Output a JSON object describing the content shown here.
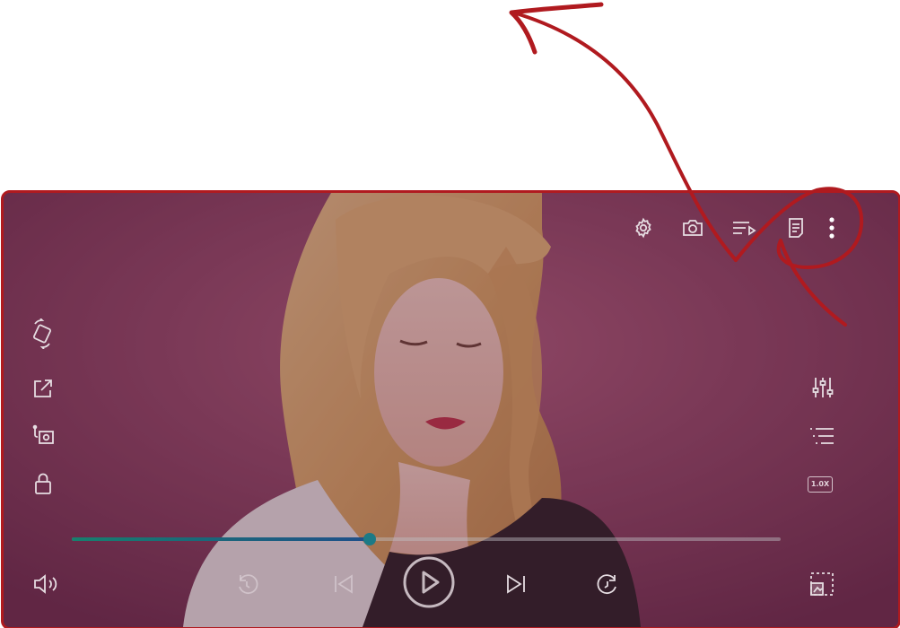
{
  "player": {
    "speed_label": "1.0X",
    "playback_progress": 0.42,
    "progress_fill_color": "#1f4f8a",
    "progress_start_color": "#17806e",
    "accent_color": "#1c7a86",
    "frame_color": "#b01a1f",
    "top_toolbar": {
      "icons": [
        "settings-icon",
        "camera-icon",
        "playlist-play-icon",
        "subtitles-icon",
        "more-vertical-icon"
      ]
    },
    "left_toolbar": {
      "icons": [
        "rotate-screen-icon",
        "open-external-icon",
        "audio-track-icon",
        "lock-icon"
      ]
    },
    "right_toolbar": {
      "icons": [
        "equalizer-icon",
        "playlist-icon",
        "playback-speed-icon"
      ]
    },
    "bottom_controls": {
      "icons": [
        "volume-icon",
        "rewind-icon",
        "skip-previous-icon",
        "play-icon",
        "skip-next-icon",
        "forward-icon",
        "picture-in-picture-icon"
      ]
    }
  },
  "annotation": {
    "color": "#b01a1f",
    "shapes": [
      "curved-arrow",
      "circle-highlight"
    ]
  }
}
